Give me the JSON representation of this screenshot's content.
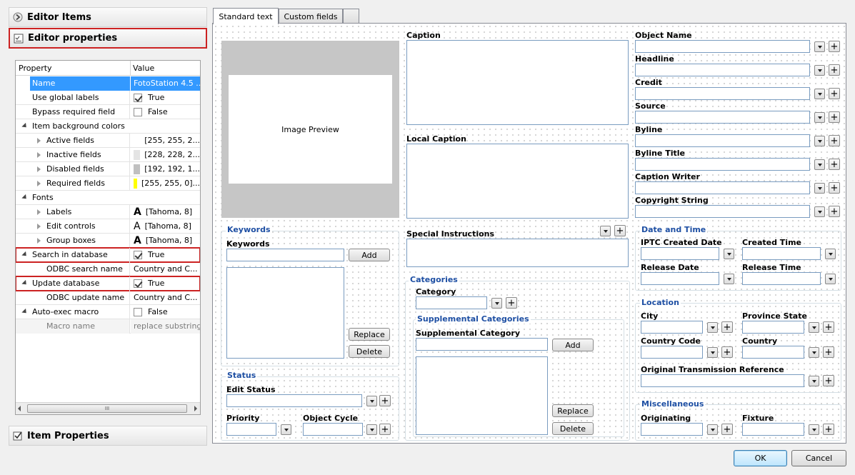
{
  "left": {
    "editor_items": "Editor Items",
    "editor_properties": "Editor properties",
    "item_properties": "Item Properties",
    "grid": {
      "header_property": "Property",
      "header_value": "Value",
      "rows": [
        {
          "name": "Name",
          "value": "FotoStation 4.5 ..."
        },
        {
          "name": "Use global labels",
          "value": "True"
        },
        {
          "name": "Bypass required field",
          "value": "False"
        },
        {
          "name": "Item background colors",
          "value": ""
        },
        {
          "name": "Active fields",
          "value": "[255, 255, 2..."
        },
        {
          "name": "Inactive fields",
          "value": "[228, 228, 2..."
        },
        {
          "name": "Disabled fields",
          "value": "[192, 192, 1..."
        },
        {
          "name": "Required fields",
          "value": "[255, 255, 0]..."
        },
        {
          "name": "Fonts",
          "value": ""
        },
        {
          "name": "Labels",
          "value": "[Tahoma, 8]"
        },
        {
          "name": "Edit controls",
          "value": "[Tahoma, 8]"
        },
        {
          "name": "Group boxes",
          "value": "[Tahoma, 8]"
        },
        {
          "name": "Search in database",
          "value": "True"
        },
        {
          "name": "ODBC search name",
          "value": "Country and C..."
        },
        {
          "name": "Update database",
          "value": "True"
        },
        {
          "name": "ODBC update name",
          "value": "Country and C..."
        },
        {
          "name": "Auto-exec macro",
          "value": "False"
        },
        {
          "name": "Macro name",
          "value": "replace substring"
        }
      ],
      "scroll_thumb": "III"
    },
    "colors": {
      "active": "#ffffff",
      "inactive": "#e4e4e4",
      "disabled": "#c0c0c0",
      "required": "#ffff00",
      "selection": "#3399ff",
      "highlight": "#cc2222"
    }
  },
  "tabs": [
    "Standard text",
    "Custom fields"
  ],
  "form": {
    "image_preview": "Image Preview",
    "caption": "Caption",
    "local_caption": "Local Caption",
    "special_instructions": "Special Instructions",
    "keywords_group": "Keywords",
    "keywords_label": "Keywords",
    "add": "Add",
    "replace": "Replace",
    "delete": "Delete",
    "status_group": "Status",
    "edit_status": "Edit Status",
    "priority": "Priority",
    "object_cycle": "Object Cycle",
    "categories_group": "Categories",
    "category": "Category",
    "supp_categories_group": "Supplemental Categories",
    "supp_category": "Supplemental Category",
    "right_fields": [
      "Object Name",
      "Headline",
      "Credit",
      "Source",
      "Byline",
      "Byline Title",
      "Caption Writer",
      "Copyright String"
    ],
    "datetime_group": "Date and Time",
    "iptc_created_date": "IPTC Created Date",
    "created_time": "Created Time",
    "release_date": "Release Date",
    "release_time": "Release Time",
    "location_group": "Location",
    "city": "City",
    "province_state": "Province State",
    "country_code": "Country Code",
    "country": "Country",
    "otr": "Original Transmission Reference",
    "misc_group": "Miscellaneous",
    "originating": "Originating",
    "fixture": "Fixture"
  },
  "footer": {
    "ok": "OK",
    "cancel": "Cancel"
  }
}
